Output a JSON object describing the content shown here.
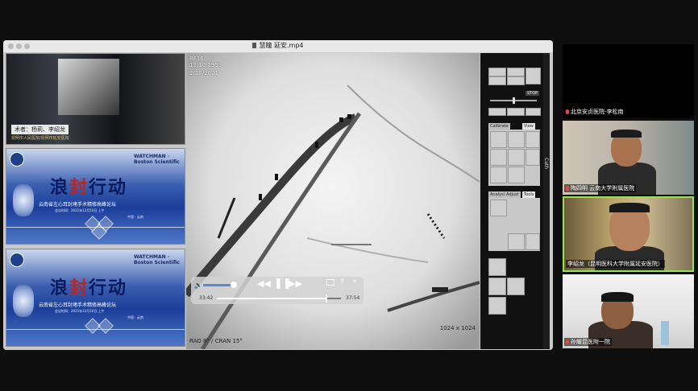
{
  "window": {
    "title": "慧瞳 延安.mp4"
  },
  "slides": {
    "thumb1": {
      "caption": "术者：杨莉、李绍龙",
      "subcaption": "昆明市人民医院/昆明市延安医院"
    },
    "deck": {
      "title_pre": "浪",
      "title_red": "封",
      "title_post": "行动",
      "subtitle": "云南省左心耳封堵手术精修高峰论坛",
      "brand": "WATCHMAN",
      "partner": "Boston Scientific",
      "meta": "会议时间：2021年12月10日 上午",
      "location": "中国 · 云南"
    }
  },
  "viewer": {
    "overlay_id": "8616",
    "overlay_date1": "12/10/1953",
    "overlay_date2": "2/10/2021",
    "resolution": "1024 x 1024",
    "view_label": "RAO 8° / CRAN 15°"
  },
  "player": {
    "elapsed": "33:42",
    "remaining": "37:54",
    "progress_fraction": 0.88,
    "volume_fraction": 0.9
  },
  "toolpanel": {
    "stop_label": "STOP",
    "tabs_top": [
      "Calibrate",
      "View"
    ],
    "tabs_bottom": [
      "Analysis",
      "Adjust",
      "Tools"
    ],
    "side_label": "Cath"
  },
  "participants": [
    {
      "name": "北京安贞医院-李松南"
    },
    {
      "name": "陶四明 云南大学附属医院"
    },
    {
      "name": "李绍龙（昆明医科大学附属延安医院）"
    },
    {
      "name": "孙耀昆医附一院"
    }
  ],
  "colors": {
    "active_speaker": "#97e34b",
    "muted_mic": "#e24b3b",
    "slide_blue": "#1b3e9a",
    "accent_red": "#c0241c"
  }
}
